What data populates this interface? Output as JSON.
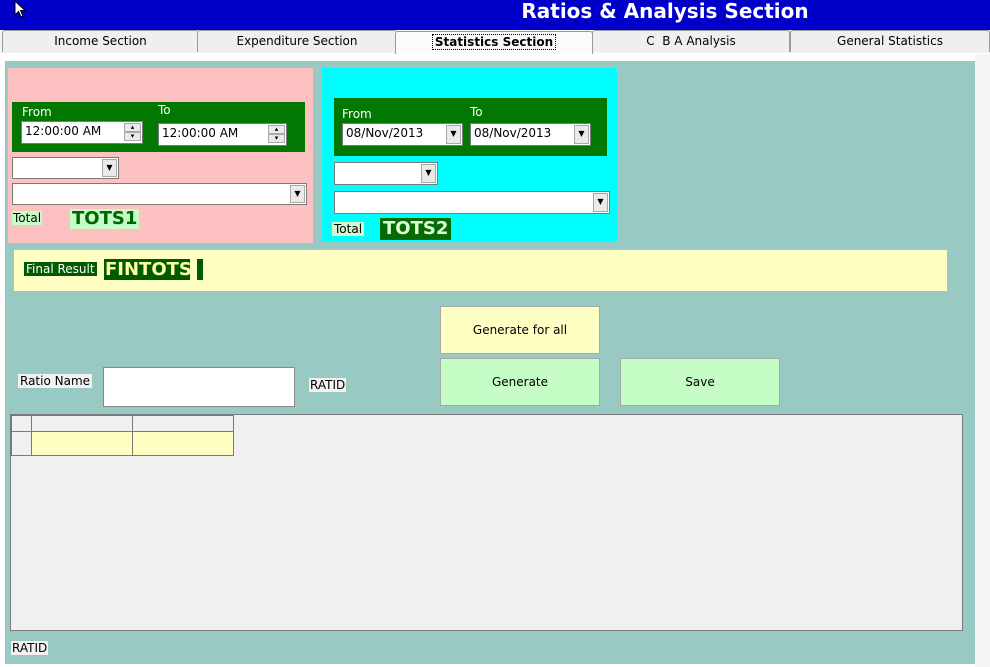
{
  "window": {
    "title": "Ratios & Analysis Section"
  },
  "tabs": [
    {
      "label": "Income Section"
    },
    {
      "label": "Expenditure Section"
    },
    {
      "label": "Statistics Section"
    },
    {
      "label": "C  B A Analysis"
    },
    {
      "label": "General Statistics"
    }
  ],
  "left_group": {
    "from_label": "From",
    "to_label": "To",
    "from_value": "12:00:00 AM",
    "to_value": "12:00:00 AM",
    "total_label": "Total",
    "total_value": "TOTS1"
  },
  "right_group": {
    "from_label": "From",
    "to_label": "To",
    "from_value": "08/Nov/2013",
    "to_value": "08/Nov/2013",
    "total_label": "Total",
    "total_value": "TOTS2"
  },
  "final": {
    "label": "Final Result",
    "value": "FINTOTS"
  },
  "buttons": {
    "generate_all": "Generate for all",
    "generate": "Generate",
    "save": "Save"
  },
  "ratio": {
    "label": "Ratio Name",
    "value": "",
    "id_label": "RATID"
  },
  "footer": {
    "id_label": "RATID"
  },
  "colors": {
    "titlebar": "#0000c8",
    "panel": "#99c9c3",
    "pink": "#fec1c1",
    "cyan": "#00fefe",
    "dark_green": "#027802",
    "light_yellow": "#ffffc4",
    "light_green": "#c6fdc6"
  }
}
